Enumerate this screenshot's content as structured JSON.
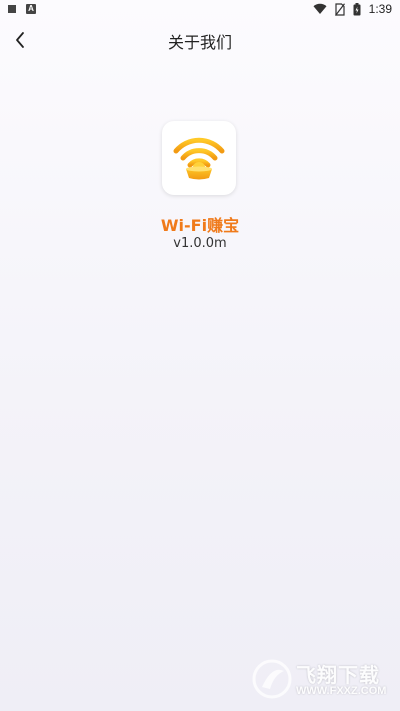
{
  "status_bar": {
    "time": "1:39",
    "left_icons": [
      "notification-square-icon",
      "a-badge-icon"
    ],
    "right_icons": [
      "wifi-icon",
      "no-sim-icon",
      "battery-icon"
    ],
    "a_badge_text": "A"
  },
  "header": {
    "back_icon": "chevron-left-icon",
    "title": "关于我们"
  },
  "app": {
    "icon": "wifi-gold-ingot-icon",
    "name": "Wi-Fi赚宝",
    "version": "v1.0.0m"
  },
  "watermark": {
    "title": "飞翔下载",
    "url": "WWW.FXXZ.COM"
  },
  "colors": {
    "accent": "#f07a1a",
    "icon_gold": "#f5b21a"
  }
}
